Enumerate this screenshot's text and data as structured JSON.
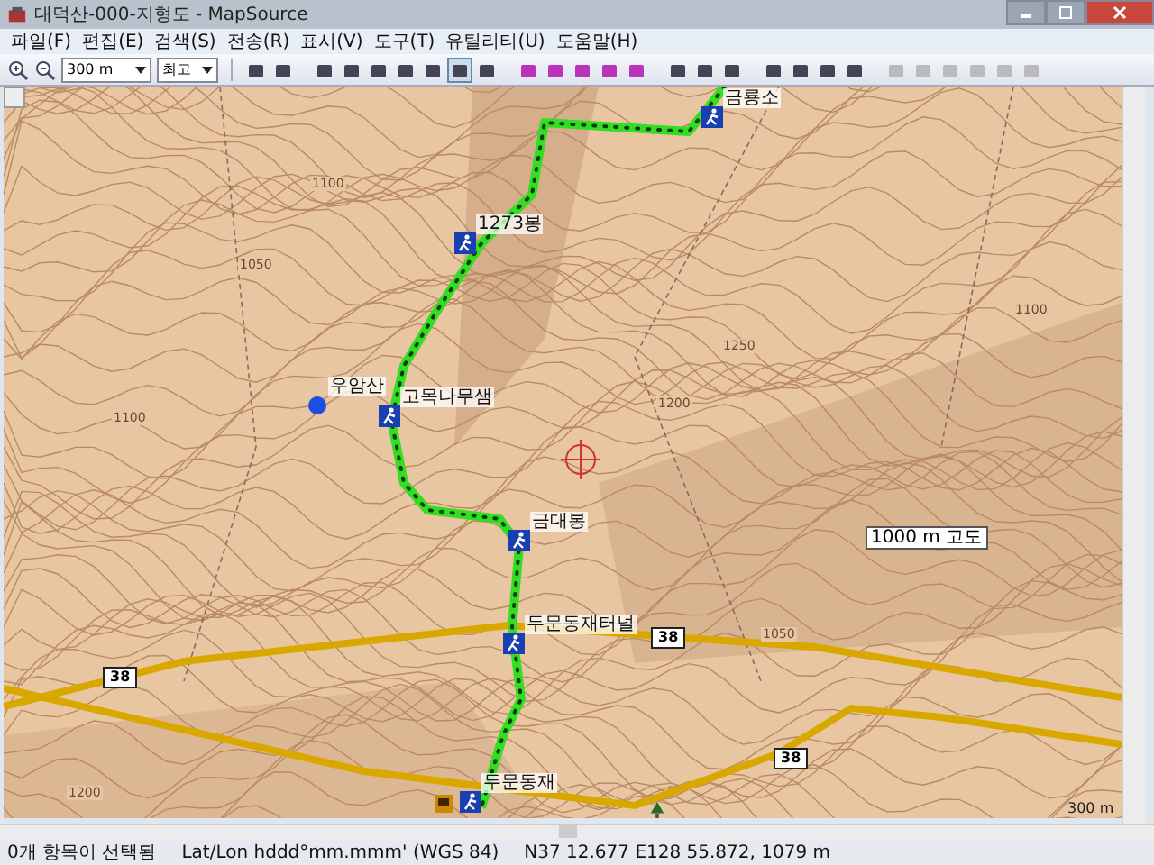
{
  "window": {
    "title": "대덕산-000-지형도 - MapSource"
  },
  "menu": [
    "파일(F)",
    "편집(E)",
    "검색(S)",
    "전송(R)",
    "표시(V)",
    "도구(T)",
    "유틸리티(U)",
    "도움말(H)"
  ],
  "toolbar": {
    "zoom_select": "300 m",
    "detail_select": "최고"
  },
  "map": {
    "waypoints": [
      {
        "label": "금룡소",
        "kind": "hiker"
      },
      {
        "label": "1273봉",
        "kind": "hiker"
      },
      {
        "label": "우암산",
        "kind": "dot"
      },
      {
        "label": "고목나무샘",
        "kind": "hiker"
      },
      {
        "label": "금대봉",
        "kind": "hiker"
      },
      {
        "label": "두문동재터널",
        "kind": "hiker"
      },
      {
        "label": "두문동재",
        "kind": "hiker"
      }
    ],
    "road_shields": [
      "38",
      "38",
      "38"
    ],
    "contour_labels": [
      "1100",
      "1250",
      "1200",
      "1050",
      "1100",
      "1100",
      "1050",
      "1200"
    ],
    "elevation_box": "1000 m 고도",
    "scale": "300 m"
  },
  "status_bar": {
    "selection": "0개 항목이 선택됨",
    "format": "Lat/Lon hddd°mm.mmm' (WGS 84)",
    "position": "N37 12.677 E128 55.872, 1079 m"
  }
}
